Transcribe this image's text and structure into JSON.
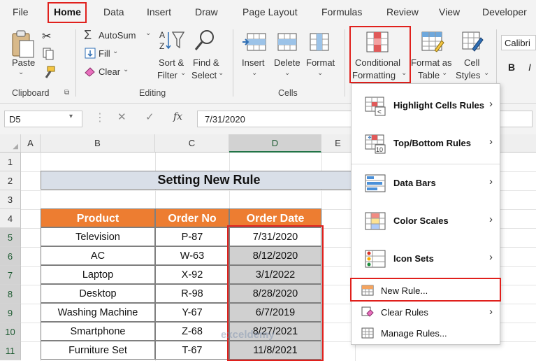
{
  "tabs": {
    "file": "File",
    "home": "Home",
    "data": "Data",
    "insert": "Insert",
    "draw": "Draw",
    "page_layout": "Page Layout",
    "formulas": "Formulas",
    "review": "Review",
    "view": "View",
    "developer": "Developer",
    "active": "Home"
  },
  "ribbon": {
    "paste": "Paste",
    "clipboard_group": "Clipboard",
    "autosum": "AutoSum",
    "fill": "Fill",
    "clear": "Clear",
    "sort_filter_1": "Sort &",
    "sort_filter_2": "Filter",
    "find_select_1": "Find &",
    "find_select_2": "Select",
    "editing_group": "Editing",
    "insert": "Insert",
    "delete": "Delete",
    "format": "Format",
    "cells_group": "Cells",
    "cond_fmt_1": "Conditional",
    "cond_fmt_2": "Formatting",
    "format_table_1": "Format as",
    "format_table_2": "Table",
    "cell_styles_1": "Cell",
    "cell_styles_2": "Styles",
    "font_name": "Calibri",
    "bold": "B",
    "italic": "I"
  },
  "formula_bar": {
    "name_box": "D5",
    "fx": "fx",
    "value": "7/31/2020"
  },
  "grid": {
    "columns": [
      "A",
      "B",
      "C",
      "D",
      "E"
    ],
    "selected_column": "D",
    "rows": [
      "1",
      "2",
      "3",
      "4",
      "5",
      "6",
      "7",
      "8",
      "9",
      "10",
      "11"
    ],
    "title": "Setting New Rule",
    "headers": [
      "Product",
      "Order No",
      "Order Date"
    ],
    "data": [
      [
        "Television",
        "P-87",
        "7/31/2020"
      ],
      [
        "AC",
        "W-63",
        "8/12/2020"
      ],
      [
        "Laptop",
        "X-92",
        "3/1/2022"
      ],
      [
        "Desktop",
        "R-98",
        "8/28/2020"
      ],
      [
        "Washing Machine",
        "Y-67",
        "6/7/2019"
      ],
      [
        "Smartphone",
        "Z-68",
        "8/27/2021"
      ],
      [
        "Furniture Set",
        "T-67",
        "11/8/2021"
      ]
    ]
  },
  "menu": {
    "highlight": "Highlight Cells Rules",
    "topbottom": "Top/Bottom Rules",
    "databars": "Data Bars",
    "colorscales": "Color Scales",
    "iconsets": "Icon Sets",
    "newrule": "New Rule...",
    "clearrules": "Clear Rules",
    "managerules": "Manage Rules..."
  },
  "watermark": "exceldemy",
  "colors": {
    "header_orange": "#ed7d31",
    "highlight_red": "#e0201c",
    "excel_green": "#217346",
    "title_fill": "#d9dfe8",
    "date_fill": "#d0d0d0"
  }
}
